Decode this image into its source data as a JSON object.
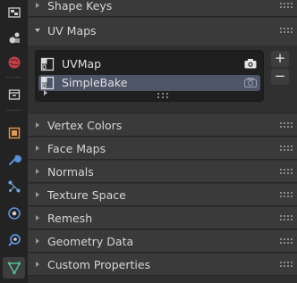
{
  "tabs": [
    {
      "icon": "texture-icon",
      "active": false
    },
    {
      "icon": "scene-icon",
      "active": false
    },
    {
      "icon": "world-icon",
      "active": false
    },
    {
      "icon": "collection-icon",
      "active": false
    },
    {
      "icon": "object-icon",
      "active": false
    },
    {
      "icon": "wrench-modifier-icon",
      "active": false
    },
    {
      "icon": "particles-icon",
      "active": false
    },
    {
      "icon": "physics-icon",
      "active": false
    },
    {
      "icon": "constraint-icon",
      "active": false
    },
    {
      "icon": "mesh-data-icon",
      "active": true
    }
  ],
  "panels": {
    "shape_keys": "Shape Keys",
    "uv_maps": "UV Maps",
    "vertex_colors": "Vertex Colors",
    "face_maps": "Face Maps",
    "normals": "Normals",
    "texture_space": "Texture Space",
    "remesh": "Remesh",
    "geometry_data": "Geometry Data",
    "custom_properties": "Custom Properties"
  },
  "uv_maps": {
    "items": [
      {
        "name": "UVMap",
        "active_render": true,
        "selected": false
      },
      {
        "name": "SimpleBake",
        "active_render": false,
        "selected": true
      }
    ],
    "add_label": "+",
    "remove_label": "−"
  },
  "colors": {
    "accent_selection": "#4d5568",
    "mesh_data_tab": "#4fbf8a"
  }
}
